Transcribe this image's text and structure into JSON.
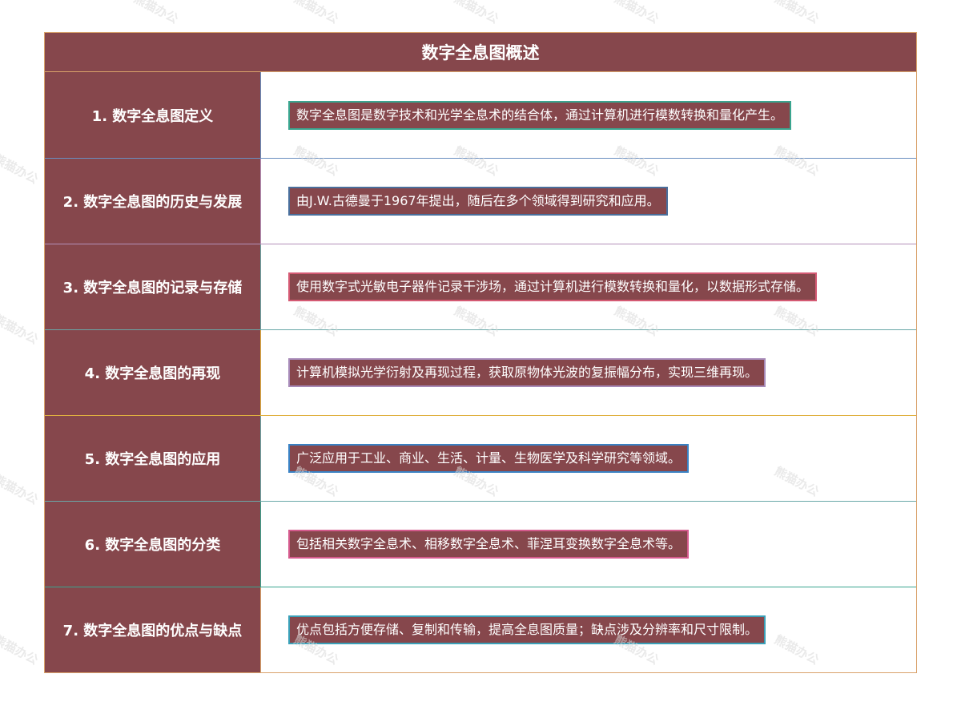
{
  "title": "数字全息图概述",
  "watermark": "熊猫办公",
  "rows": [
    {
      "label": "1. 数字全息图定义",
      "text": "数字全息图是数字技术和光学全息术的结合体，通过计算机进行模数转换和量化产生。",
      "accent": "#3aa58f"
    },
    {
      "label": "2. 数字全息图的历史与发展",
      "text": "由J.W.古德曼于1967年提出，随后在多个领域得到研究和应用。",
      "accent": "#4a6f9c"
    },
    {
      "label": "3. 数字全息图的记录与存储",
      "text": "使用数字式光敏电子器件记录干涉场，通过计算机进行模数转换和量化，以数据形式存储。",
      "accent": "#d45a73"
    },
    {
      "label": "4. 数字全息图的再现",
      "text": "计算机模拟光学衍射及再现过程，获取原物体光波的复振幅分布，实现三维再现。",
      "accent": "#a78ab8"
    },
    {
      "label": "5. 数字全息图的应用",
      "text": "广泛应用于工业、商业、生活、计量、生物医学及科学研究等领域。",
      "accent": "#3a82c4"
    },
    {
      "label": "6. 数字全息图的分类",
      "text": "包括相关数字全息术、相移数字全息术、菲涅耳变换数字全息术等。",
      "accent": "#d45a8c"
    },
    {
      "label": "7. 数字全息图的优点与缺点",
      "text": "优点包括方便存储、复制和传输，提高全息图质量；缺点涉及分辨率和尺寸限制。",
      "accent": "#3aa0b8"
    }
  ],
  "row_borders": [
    "#6a8fc0",
    "#b490b8",
    "#6aa8a8",
    "#e0b040",
    "#6aa8a8",
    "#3aa58f",
    "#d9a26b"
  ]
}
